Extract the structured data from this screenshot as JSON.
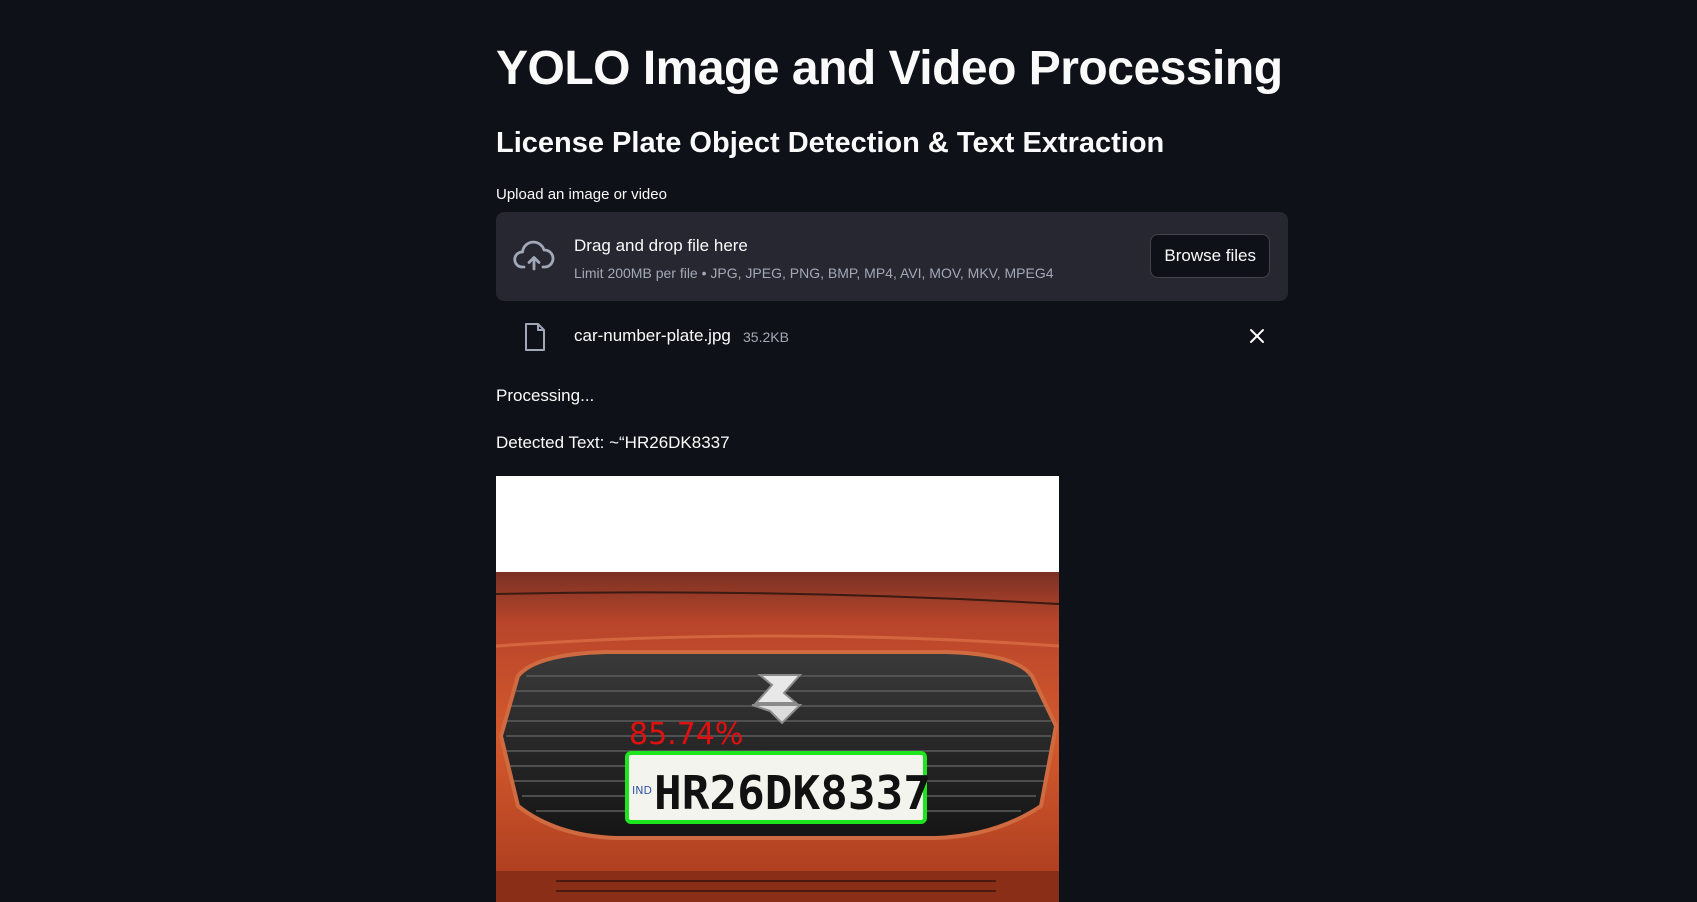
{
  "header": {
    "title": "YOLO Image and Video Processing",
    "subtitle": "License Plate Object Detection & Text Extraction"
  },
  "uploader": {
    "label": "Upload an image or video",
    "drag_text": "Drag and drop file here",
    "limits": "Limit 200MB per file • JPG, JPEG, PNG, BMP, MP4, AVI, MOV, MKV, MPEG4",
    "browse_label": "Browse files",
    "icon": "cloud-upload-icon"
  },
  "file": {
    "name": "car-number-plate.jpg",
    "size": "35.2KB",
    "icon": "file-icon"
  },
  "status": {
    "processing": "Processing...",
    "detected_prefix": "Detected Text:",
    "detected_value": "~“HR26DK8337"
  },
  "result_image": {
    "confidence": "85.74%",
    "plate_text": "HR26DK8337",
    "plate_country": "IND",
    "box_color": "#1ee61e",
    "label_color": "#e01010",
    "car_color": "#c4451f"
  }
}
